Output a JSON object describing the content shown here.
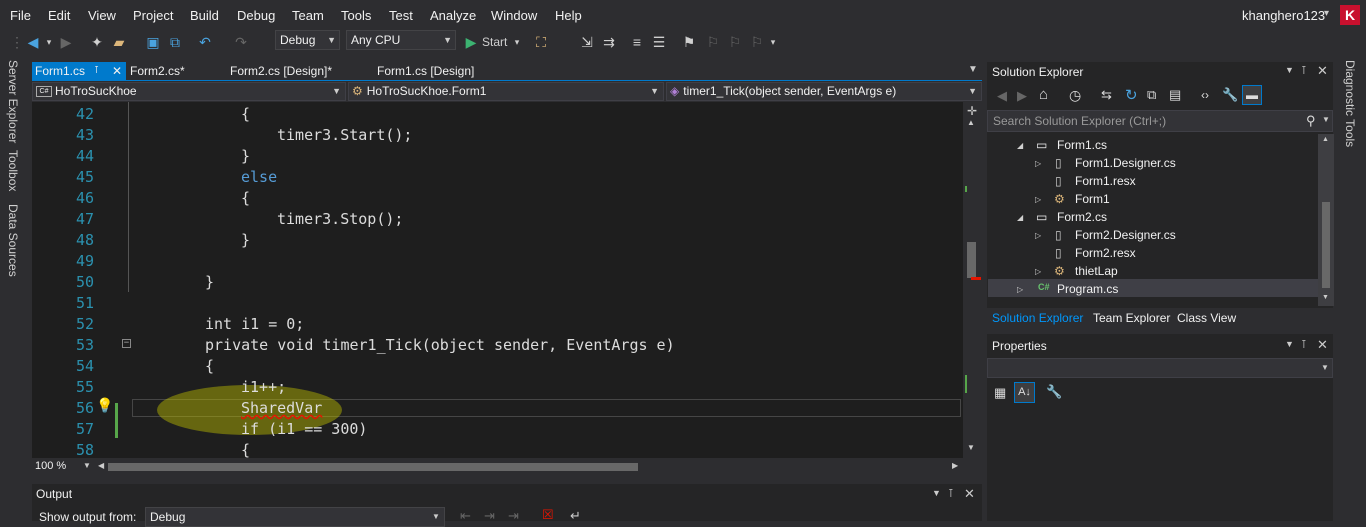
{
  "menu": [
    "File",
    "Edit",
    "View",
    "Project",
    "Build",
    "Debug",
    "Team",
    "Tools",
    "Test",
    "Analyze",
    "Window",
    "Help"
  ],
  "user": {
    "name": "khanghero123",
    "avatar_letter": "K",
    "avatar_color": "#c8102e"
  },
  "toolbar": {
    "config": "Debug",
    "platform": "Any CPU",
    "start_label": "Start"
  },
  "left_tabs": [
    "Server Explorer",
    "Toolbox",
    "Data Sources"
  ],
  "right_tabs": [
    "Diagnostic Tools"
  ],
  "doc_tabs": [
    {
      "label": "Form1.cs",
      "pin": "⊺",
      "close": "✕"
    },
    {
      "label": "Form2.cs*"
    },
    {
      "label": "Form2.cs [Design]*"
    },
    {
      "label": "Form1.cs [Design]"
    }
  ],
  "nav": {
    "project": "HoTroSucKhoe",
    "class": "HoTroSucKhoe.Form1",
    "member": "timer1_Tick(object sender, EventArgs e)"
  },
  "editor": {
    "zoom": "100 %",
    "lines": [
      {
        "n": "42",
        "text": "{"
      },
      {
        "n": "43",
        "text": "timer3.Start();"
      },
      {
        "n": "44",
        "text": "}"
      },
      {
        "n": "45",
        "text": "else"
      },
      {
        "n": "46",
        "text": "{"
      },
      {
        "n": "47",
        "text": "timer3.Stop();"
      },
      {
        "n": "48",
        "text": "}"
      },
      {
        "n": "49",
        "text": ""
      },
      {
        "n": "50",
        "text": "}"
      },
      {
        "n": "51",
        "text": ""
      },
      {
        "n": "52",
        "text": "int i1 = 0;"
      },
      {
        "n": "53",
        "text": "private void timer1_Tick(object sender, EventArgs e)"
      },
      {
        "n": "54",
        "text": "{"
      },
      {
        "n": "55",
        "text": "i1++;"
      },
      {
        "n": "56",
        "text": "SharedVar"
      },
      {
        "n": "57",
        "text": "if (i1 == 300)"
      },
      {
        "n": "58",
        "text": "{"
      }
    ]
  },
  "solution_explorer": {
    "title": "Solution Explorer",
    "search_placeholder": "Search Solution Explorer (Ctrl+;)",
    "items": [
      "Form1.cs",
      "Form1.Designer.cs",
      "Form1.resx",
      "Form1",
      "Form2.cs",
      "Form2.Designer.cs",
      "Form2.resx",
      "thietLap",
      "Program.cs"
    ],
    "cs_badge": "C#",
    "tabs": [
      "Solution Explorer",
      "Team Explorer",
      "Class View"
    ]
  },
  "properties": {
    "title": "Properties"
  },
  "output": {
    "title": "Output",
    "show_label": "Show output from:",
    "source": "Debug"
  },
  "colors": {
    "accent": "#007acc",
    "keyword": "#569cd6",
    "type": "#4ec9b0",
    "line_number": "#2b91af",
    "background": "#1e1e1e"
  }
}
